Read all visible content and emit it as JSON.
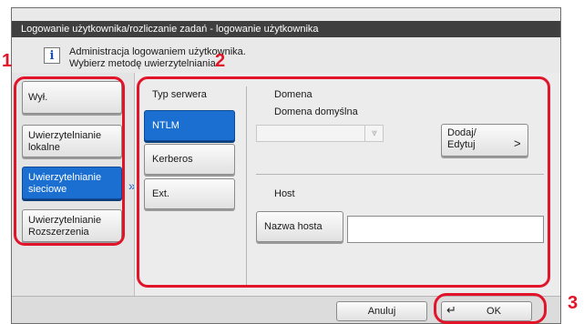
{
  "window": {
    "title": "Logowanie użytkownika/rozliczanie zadań - logowanie użytkownika"
  },
  "info": {
    "icon": "info-icon",
    "line1": "Administracja logowaniem użytkownika.",
    "line2": "Wybierz metodę uwierzytelniania."
  },
  "menu": {
    "items": [
      {
        "label": "Wył.",
        "selected": false
      },
      {
        "label": "Uwierzytelnianie lokalne",
        "selected": false
      },
      {
        "label": "Uwierzytelnianie sieciowe",
        "selected": true
      },
      {
        "label": "Uwierzytelnianie Rozszerzenia",
        "selected": false
      }
    ]
  },
  "server_type": {
    "heading": "Typ serwera",
    "options": [
      {
        "label": "NTLM",
        "selected": true
      },
      {
        "label": "Kerberos",
        "selected": false
      },
      {
        "label": "Ext.",
        "selected": false
      }
    ]
  },
  "domain": {
    "heading": "Domena",
    "default_label": "Domena domyślna",
    "default_value": "",
    "add_edit_label": "Dodaj/ Edytuj"
  },
  "host": {
    "heading": "Host",
    "hostname_button": "Nazwa hosta",
    "hostname_value": ""
  },
  "footer": {
    "cancel_label": "Anuluj",
    "ok_label": "OK"
  },
  "callouts": [
    "1",
    "2",
    "3"
  ],
  "colors": {
    "selected": "#1b6fd1",
    "titlebar": "#3f3f3f",
    "highlight": "#e1142a"
  }
}
